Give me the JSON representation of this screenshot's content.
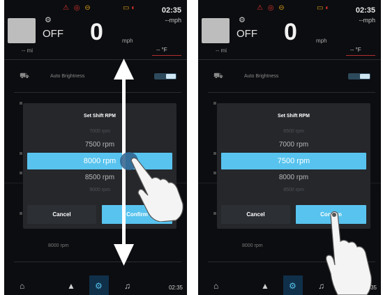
{
  "left": {
    "clock": "02:35",
    "top_unit": "--mph",
    "gear_status": "OFF",
    "speed": "0",
    "speed_unit": "mph",
    "trip": "-- mi",
    "temperature": "-- °F",
    "setting_label": "Auto Brightness",
    "background_value": "8000 rpm",
    "dialog": {
      "title": "Set Shift RPM",
      "options_above": [
        "7000 rpm",
        "7500 rpm"
      ],
      "selected": "8000 rpm",
      "options_below": [
        "8500 rpm",
        "9000 rpm"
      ],
      "cancel": "Cancel",
      "confirm": "Confirm"
    },
    "bottom_clock": "02:35"
  },
  "right": {
    "clock": "02:35",
    "top_unit": "--mph",
    "gear_status": "OFF",
    "speed": "0",
    "speed_unit": "mph",
    "trip": "-- mi",
    "temperature": "-- °F",
    "setting_label": "Auto Brightness",
    "background_value": "8000 rpm",
    "dialog": {
      "title": "Set Shift RPM",
      "options_above": [
        "6500 rpm",
        "7000 rpm"
      ],
      "selected": "7500 rpm",
      "options_below": [
        "8000 rpm",
        "8500 rpm"
      ],
      "cancel": "Cancel",
      "confirm": "Confirm"
    },
    "bottom_clock": "02:35"
  },
  "icons": {
    "warning_left": [
      "engine-warning-icon",
      "tire-pressure-icon",
      "oil-icon"
    ],
    "warning_right": [
      "battery-icon",
      "high-beam-icon"
    ],
    "nav": [
      "home-icon",
      "navigation-icon",
      "settings-icon",
      "music-icon"
    ]
  },
  "colors": {
    "accent": "#58c3ee",
    "background": "#0c0d10",
    "dialog": "#25272b",
    "warning_red": "#d9322e",
    "warning_amber": "#d49a18"
  }
}
